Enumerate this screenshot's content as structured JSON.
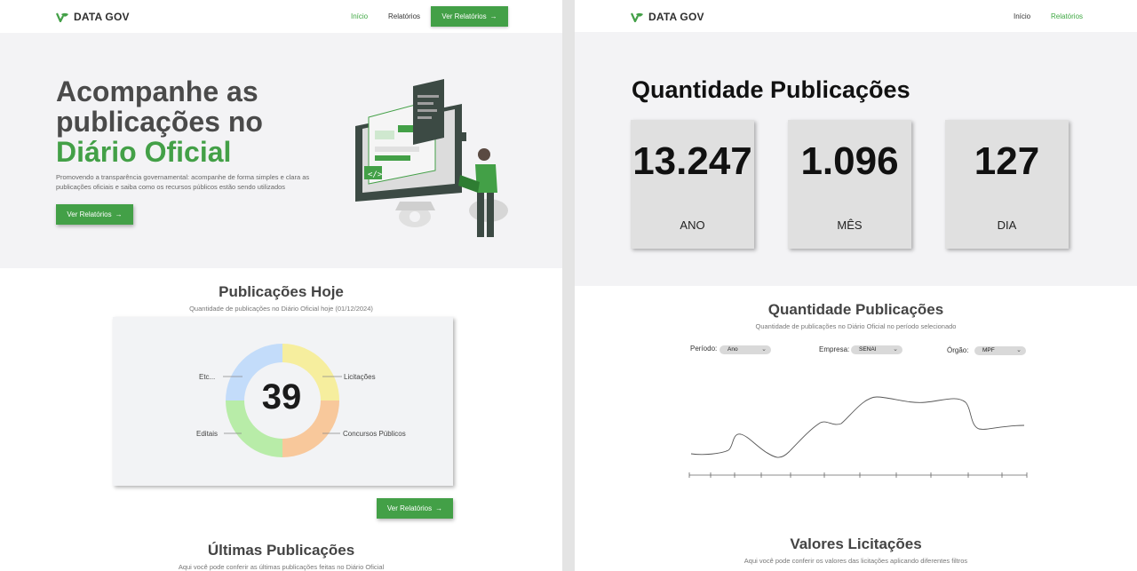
{
  "brand": {
    "name": "DATA GOV"
  },
  "colors": {
    "accent": "#43a047",
    "hero_bg": "#f3f3f5",
    "card_bg": "#e0e0e0"
  },
  "left": {
    "nav": {
      "inicio": "Início",
      "relatorios": "Relatórios",
      "cta": "Ver Relatórios",
      "arrow": "→"
    },
    "hero": {
      "title_line1": "Acompanhe as",
      "title_line2": "publicações no",
      "title_green": "Diário Oficial",
      "subtitle": "Promovendo a transparência governamental: acompanhe de forma simples e clara as publicações oficiais e saiba como os recursos públicos estão sendo utilizados",
      "button": "Ver Relatórios"
    },
    "today": {
      "title": "Publicações Hoje",
      "subtitle": "Quantidade de publicações no Diário Oficial hoje (01/12/2024)",
      "total": "39",
      "segments": [
        {
          "label": "Licitações",
          "color": "#f6ee9e"
        },
        {
          "label": "Concursos Públicos",
          "color": "#f8c89b"
        },
        {
          "label": "Editais",
          "color": "#b8eca8"
        },
        {
          "label": "Etc...",
          "color": "#c3dcfa"
        }
      ],
      "button": "Ver Relatórios"
    },
    "latest": {
      "title": "Últimas Publicações",
      "subtitle": "Aqui você pode conferir as últimas publicações feitas no Diário Oficial"
    }
  },
  "right": {
    "nav": {
      "inicio": "Início",
      "relatorios": "Relatórios"
    },
    "hero": {
      "title": "Quantidade Publicações",
      "stats": [
        {
          "value": "13.247",
          "label": "ANO"
        },
        {
          "value": "1.096",
          "label": "MÊS"
        },
        {
          "value": "127",
          "label": "DIA"
        }
      ]
    },
    "chart_section": {
      "title": "Quantidade Publicações",
      "subtitle": "Quantidade de publicações no Diário Oficial no período selecionado",
      "filters": [
        {
          "label": "Período:",
          "value": "Ano"
        },
        {
          "label": "Empresa:",
          "value": "SENAI"
        },
        {
          "label": "Órgão:",
          "value": "MPF"
        }
      ]
    },
    "values_section": {
      "title": "Valores Licitações",
      "subtitle": "Aqui você pode conferir os valores das licitações aplicando diferentes filtros"
    }
  }
}
